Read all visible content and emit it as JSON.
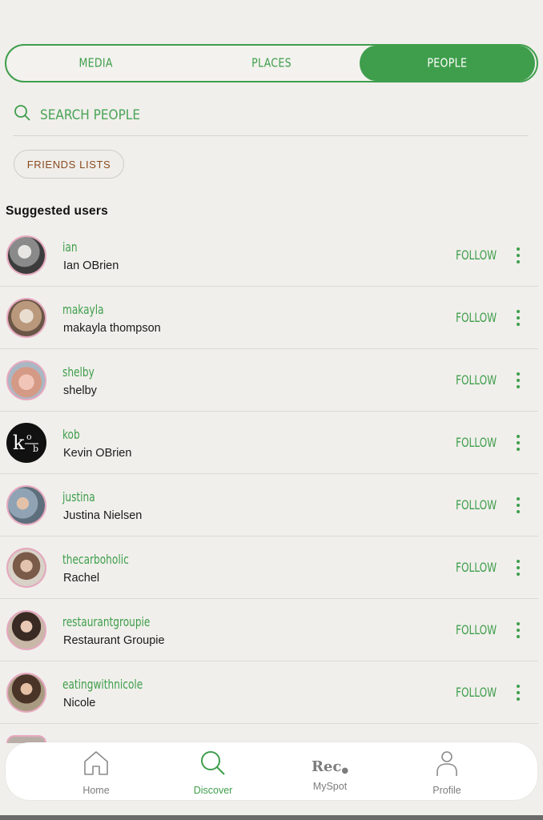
{
  "tabs": [
    {
      "label": "MEDIA",
      "active": false
    },
    {
      "label": "PLACES",
      "active": false
    },
    {
      "label": "PEOPLE",
      "active": true
    }
  ],
  "search": {
    "placeholder": "SEARCH PEOPLE",
    "value": "",
    "icon": "search-icon"
  },
  "friends_lists_label": "FRIENDS LISTS",
  "section_title": "Suggested users",
  "users": [
    {
      "handle": "ian",
      "name": "Ian OBrien",
      "action": "FOLLOW",
      "avatar_color": "#8f8f8f"
    },
    {
      "handle": "makayla",
      "name": "makayla thompson",
      "action": "FOLLOW",
      "avatar_color": "#c8b4a0"
    },
    {
      "handle": "shelby",
      "name": "shelby",
      "action": "FOLLOW",
      "avatar_color": "#d7a9a6"
    },
    {
      "handle": "kob",
      "name": "Kevin OBrien",
      "action": "FOLLOW",
      "avatar_color": "#111111",
      "logo_text": "k o b"
    },
    {
      "handle": "justina",
      "name": "Justina Nielsen",
      "action": "FOLLOW",
      "avatar_color": "#9eb6c9"
    },
    {
      "handle": "thecarboholic",
      "name": "Rachel",
      "action": "FOLLOW",
      "avatar_color": "#b89a82"
    },
    {
      "handle": "restaurantgroupie",
      "name": "Restaurant Groupie",
      "action": "FOLLOW",
      "avatar_color": "#8a6a5a"
    },
    {
      "handle": "eatingwithnicole",
      "name": "Nicole",
      "action": "FOLLOW",
      "avatar_color": "#7a6a55"
    }
  ],
  "nav": [
    {
      "label": "Home",
      "icon": "home-icon",
      "active": false
    },
    {
      "label": "Discover",
      "icon": "search-icon",
      "active": true
    },
    {
      "label": "MySpot",
      "icon": "rec-logo",
      "logo_text": "Rec",
      "active": false
    },
    {
      "label": "Profile",
      "icon": "profile-icon",
      "active": false
    }
  ],
  "colors": {
    "accent": "#3f9e4c",
    "background": "#f0efeb",
    "friends_text": "#8a4a1f",
    "avatar_ring": "#e7a8c0"
  }
}
